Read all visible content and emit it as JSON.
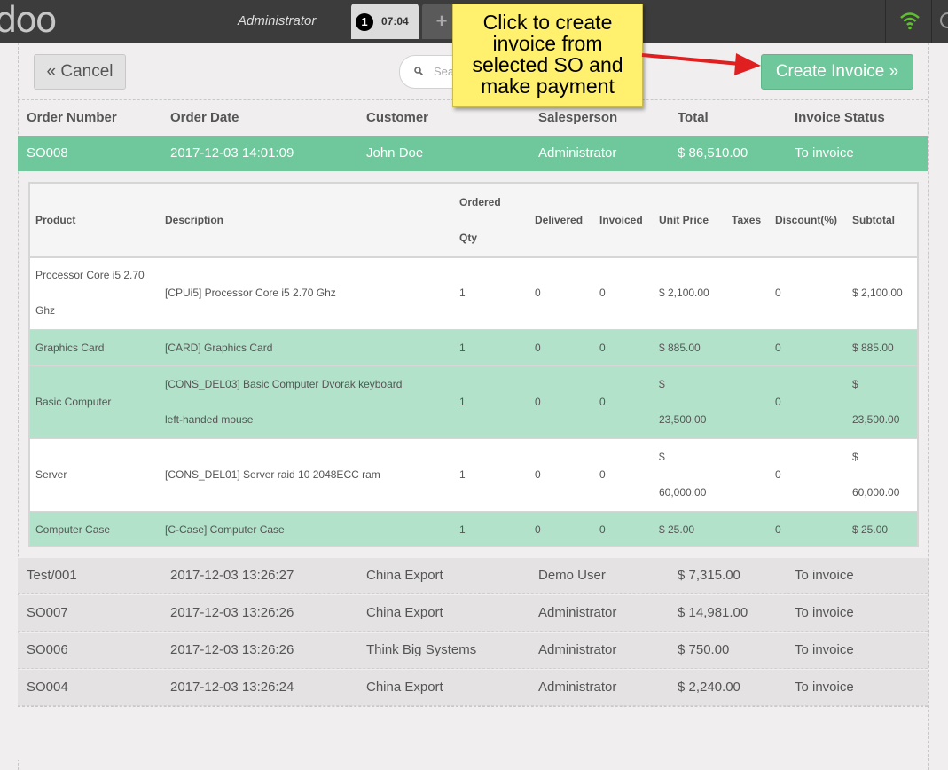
{
  "topbar": {
    "logo": "doo",
    "user": "Administrator",
    "order_number": "1",
    "order_time": "07:04",
    "add_label": "+"
  },
  "controls": {
    "cancel_label": "« Cancel",
    "search_placeholder": "Sea",
    "create_invoice_label": "Create Invoice »"
  },
  "callout": {
    "lines": [
      "Click to create",
      "invoice from",
      "selected SO and",
      "make payment"
    ]
  },
  "orders": {
    "columns": [
      "Order Number",
      "Order Date",
      "Customer",
      "Salesperson",
      "Total",
      "Invoice Status"
    ],
    "selected": {
      "number": "SO008",
      "date": "2017-12-03 14:01:09",
      "customer": "John Doe",
      "salesperson": "Administrator",
      "total": "$ 86,510.00",
      "status": "To invoice"
    },
    "rows": [
      {
        "number": "Test/001",
        "date": "2017-12-03 13:26:27",
        "customer": "China Export",
        "salesperson": "Demo User",
        "total": "$ 7,315.00",
        "status": "To invoice"
      },
      {
        "number": "SO007",
        "date": "2017-12-03 13:26:26",
        "customer": "China Export",
        "salesperson": "Administrator",
        "total": "$ 14,981.00",
        "status": "To invoice"
      },
      {
        "number": "SO006",
        "date": "2017-12-03 13:26:26",
        "customer": "Think Big Systems",
        "salesperson": "Administrator",
        "total": "$ 750.00",
        "status": "To invoice"
      },
      {
        "number": "SO004",
        "date": "2017-12-03 13:26:24",
        "customer": "China Export",
        "salesperson": "Administrator",
        "total": "$ 2,240.00",
        "status": "To invoice"
      }
    ]
  },
  "lines": {
    "columns": {
      "product": "Product",
      "description": "Description",
      "ordered_1": "Ordered",
      "ordered_2": "Qty",
      "delivered": "Delivered",
      "invoiced": "Invoiced",
      "unit_price": "Unit Price",
      "taxes": "Taxes",
      "discount": "Discount(%)",
      "subtotal": "Subtotal"
    },
    "items": [
      {
        "product_1": "Processor Core i5 2.70",
        "product_2": "Ghz",
        "description_1": "[CPUi5] Processor Core i5 2.70 Ghz",
        "description_2": "",
        "qty": "1",
        "delivered": "0",
        "invoiced": "0",
        "price_1": "$ 2,100.00",
        "price_2": "",
        "discount": "0",
        "subtotal_1": "$ 2,100.00",
        "subtotal_2": ""
      },
      {
        "product_1": "Graphics Card",
        "product_2": "",
        "description_1": "[CARD] Graphics Card",
        "description_2": "",
        "qty": "1",
        "delivered": "0",
        "invoiced": "0",
        "price_1": "$ 885.00",
        "price_2": "",
        "discount": "0",
        "subtotal_1": "$ 885.00",
        "subtotal_2": ""
      },
      {
        "product_1": "Basic Computer",
        "product_2": "",
        "description_1": "[CONS_DEL03] Basic Computer Dvorak keyboard",
        "description_2": "left-handed mouse",
        "qty": "1",
        "delivered": "0",
        "invoiced": "0",
        "price_1": "$",
        "price_2": "23,500.00",
        "discount": "0",
        "subtotal_1": "$",
        "subtotal_2": "23,500.00"
      },
      {
        "product_1": "Server",
        "product_2": "",
        "description_1": "[CONS_DEL01] Server raid 10 2048ECC ram",
        "description_2": "",
        "qty": "1",
        "delivered": "0",
        "invoiced": "0",
        "price_1": "$",
        "price_2": "60,000.00",
        "discount": "0",
        "subtotal_1": "$",
        "subtotal_2": "60,000.00"
      },
      {
        "product_1": "Computer Case",
        "product_2": "",
        "description_1": "[C-Case] Computer Case",
        "description_2": "",
        "qty": "1",
        "delivered": "0",
        "invoiced": "0",
        "price_1": "$ 25.00",
        "price_2": "",
        "discount": "0",
        "subtotal_1": "$ 25.00",
        "subtotal_2": ""
      }
    ]
  },
  "colors": {
    "accent": "#6ec89b",
    "line_highlight": "#b2e2c9",
    "callout": "#fff06e",
    "arrow": "#e02020",
    "wifi": "#5fbf2e"
  }
}
